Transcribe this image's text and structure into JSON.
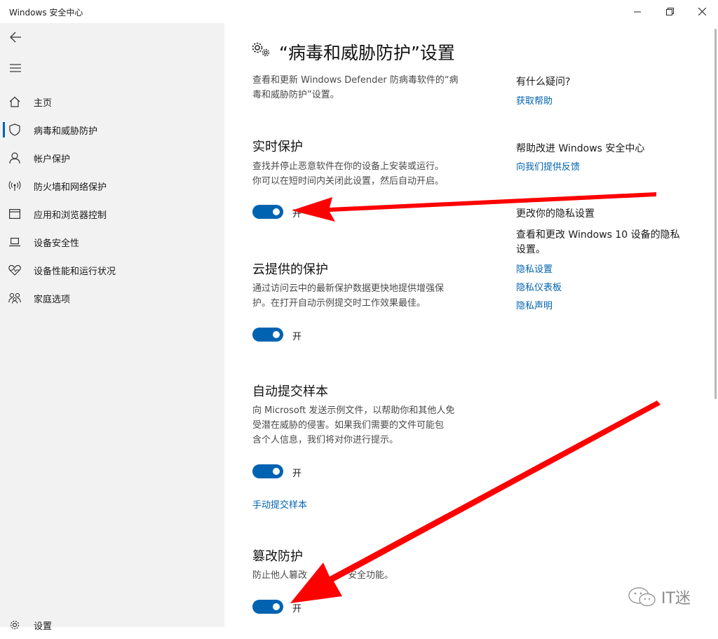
{
  "window": {
    "title": "Windows 安全中心"
  },
  "sidebar": {
    "items": [
      {
        "label": "主页",
        "icon": "home-icon"
      },
      {
        "label": "病毒和威胁防护",
        "icon": "shield-icon"
      },
      {
        "label": "帐户保护",
        "icon": "person-icon"
      },
      {
        "label": "防火墙和网络保护",
        "icon": "wireless-icon"
      },
      {
        "label": "应用和浏览器控制",
        "icon": "app-window-icon"
      },
      {
        "label": "设备安全性",
        "icon": "laptop-icon"
      },
      {
        "label": "设备性能和运行状况",
        "icon": "heart-icon"
      },
      {
        "label": "家庭选项",
        "icon": "family-icon"
      }
    ],
    "settings_label": "设置"
  },
  "main": {
    "title": "“病毒和威胁防护”设置",
    "intro_line1": "查看和更新 Windows Defender 防病毒软件的“病",
    "intro_line2": "毒和威胁防护”设置。",
    "realtime": {
      "title": "实时保护",
      "desc_line1": "查找并停止恶意软件在你的设备上安装或运行。",
      "desc_line2": "你可以在短时间内关闭此设置，然后自动开启。",
      "toggle_label": "开"
    },
    "cloud": {
      "title": "云提供的保护",
      "desc_line1": "通过访问云中的最新保护数据更快地提供增强保",
      "desc_line2": "护。在打开自动示例提交时工作效果最佳。",
      "toggle_label": "开"
    },
    "sample": {
      "title": "自动提交样本",
      "desc_line1": "向 Microsoft 发送示例文件，以帮助你和其他人免",
      "desc_line2": "受潜在威胁的侵害。如果我们需要的文件可能包",
      "desc_line3": "含个人信息，我们将对你进行提示。",
      "toggle_label": "开",
      "link": "手动提交样本"
    },
    "tamper": {
      "title": "篡改防护",
      "desc_visible_start": "防止他人篡改",
      "desc_visible_end": "安全功能。",
      "toggle_label": "开"
    }
  },
  "side_panel": {
    "help_heading": "有什么疑问?",
    "help_link": "获取帮助",
    "improve_heading": "帮助改进 Windows 安全中心",
    "improve_link": "向我们提供反馈",
    "privacy_heading": "更改你的隐私设置",
    "privacy_desc_line1": "查看和更改 Windows 10 设备的隐私",
    "privacy_desc_line2": "设置。",
    "privacy_links": [
      "隐私设置",
      "隐私仪表板",
      "隐私声明"
    ]
  },
  "watermark": {
    "text": "IT迷"
  },
  "colors": {
    "accent": "#0063b1",
    "sidebar_bg": "#f2f2f2",
    "arrow": "#ff0000"
  }
}
